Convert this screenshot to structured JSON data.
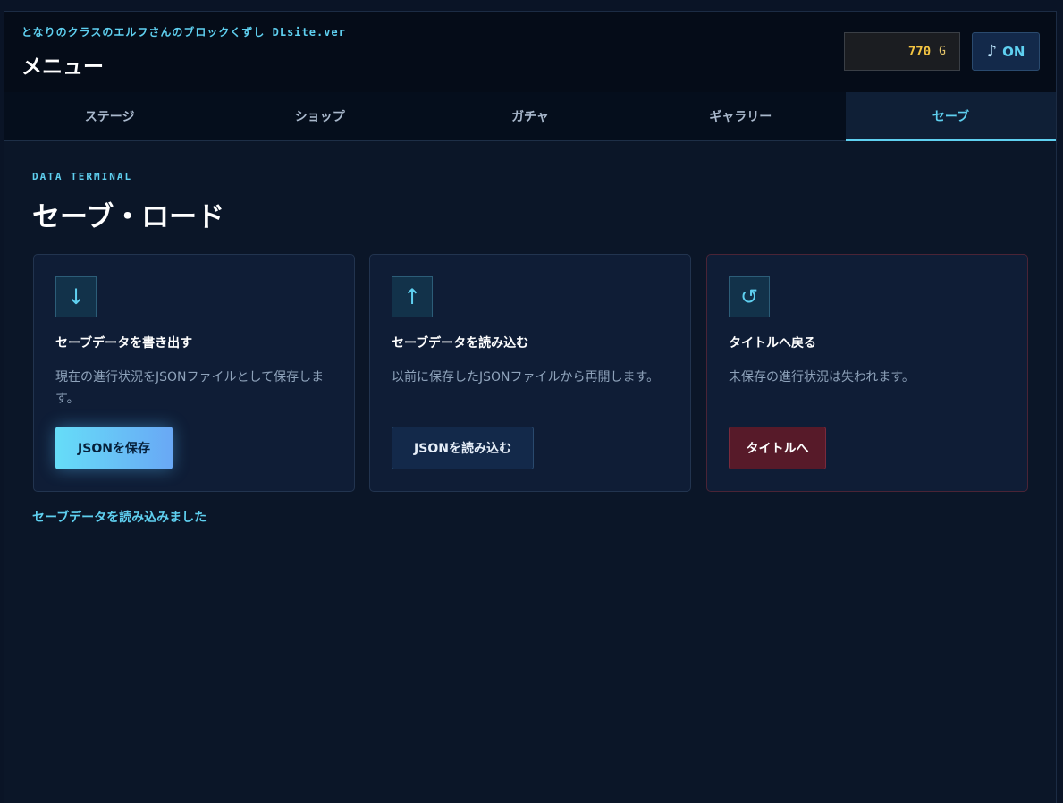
{
  "app": {
    "subtitle": "となりのクラスのエルフさんのブロックくずし DLsite.ver",
    "page_title": "メニュー"
  },
  "currency": {
    "value": "770",
    "unit": "G"
  },
  "sound": {
    "icon": "♪",
    "label": "ON"
  },
  "tabs": [
    {
      "label": "ステージ",
      "active": false
    },
    {
      "label": "ショップ",
      "active": false
    },
    {
      "label": "ガチャ",
      "active": false
    },
    {
      "label": "ギャラリー",
      "active": false
    },
    {
      "label": "セーブ",
      "active": true
    }
  ],
  "section": {
    "eyebrow": "DATA TERMINAL",
    "title": "セーブ・ロード"
  },
  "cards": [
    {
      "icon": "↓",
      "icon_name": "download-arrow-icon",
      "title": "セーブデータを書き出す",
      "description": "現在の進行状況をJSONファイルとして保存します。",
      "button": "JSONを保存"
    },
    {
      "icon": "↑",
      "icon_name": "upload-arrow-icon",
      "title": "セーブデータを読み込む",
      "description": "以前に保存したJSONファイルから再開します。",
      "button": "JSONを読み込む"
    },
    {
      "icon": "↺",
      "icon_name": "return-icon",
      "title": "タイトルへ戻る",
      "description": "未保存の進行状況は失われます。",
      "button": "タイトルへ"
    }
  ],
  "status": "セーブデータを読み込みました",
  "colors": {
    "accent": "#5fd0f0",
    "gold": "#f4c542",
    "danger": "#571a29",
    "background": "#0b1628"
  }
}
